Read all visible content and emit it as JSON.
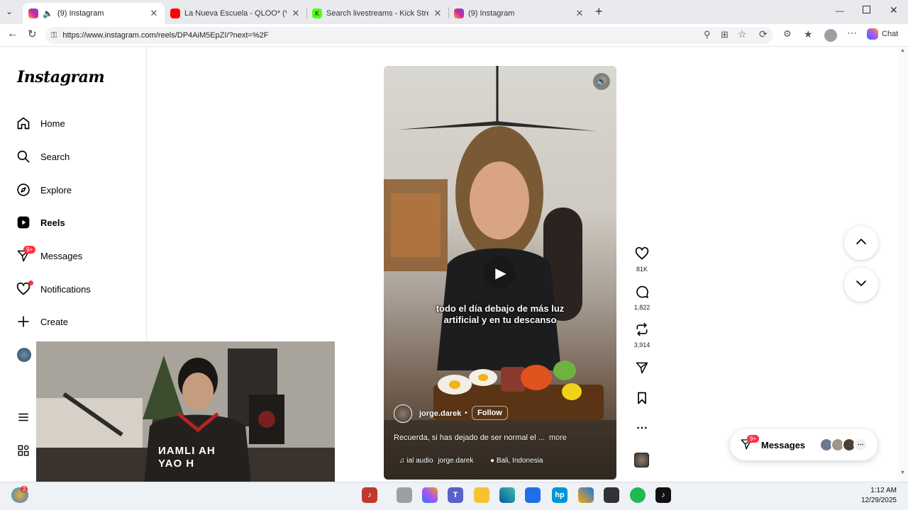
{
  "browser": {
    "tabs": [
      {
        "label": "(9) Instagram",
        "active": true,
        "icon": "instagram-icon",
        "color": "#d6249f"
      },
      {
        "label": "La Nueva Escuela - QLOO* (Video",
        "active": false,
        "icon": "youtube-icon",
        "color": "#ff0000"
      },
      {
        "label": "Search livestreams - Kick Streamin",
        "active": false,
        "icon": "kick-icon",
        "color": "#53fc18"
      },
      {
        "label": "(9) Instagram",
        "active": false,
        "icon": "instagram-icon",
        "color": "#d6249f"
      }
    ],
    "url": "https://www.instagram.com/reels/DP4AiM5EpZI/?next=%2F",
    "chat_label": "Chat"
  },
  "instagram": {
    "logo": "Instagram",
    "nav": [
      {
        "label": "Home",
        "icon": "home-icon"
      },
      {
        "label": "Search",
        "icon": "search-icon"
      },
      {
        "label": "Explore",
        "icon": "compass-icon"
      },
      {
        "label": "Reels",
        "icon": "reels-icon",
        "active": true
      },
      {
        "label": "Messages",
        "icon": "messenger-icon",
        "badge": "9+"
      },
      {
        "label": "Notifications",
        "icon": "heart-icon"
      },
      {
        "label": "Create",
        "icon": "plus-icon"
      }
    ],
    "reel": {
      "caption_line1": "todo el día debajo de más luz",
      "caption_line2": "artificial y en tu descanso",
      "username": "jorge.darek",
      "follow": "Follow",
      "description": "Recuerda, si has dejado de ser normal el ...",
      "more": "more",
      "audio": "ial audio",
      "audio_user": "jorge.darek",
      "location": "Bali, Indonesia"
    },
    "actions": {
      "likes": "81K",
      "comments": "1,822",
      "reposts": "3,914"
    },
    "messages_pill": {
      "label": "Messages",
      "badge": "9+"
    }
  },
  "webcam": {
    "shirt_text_1": "ИAMLI  AH",
    "shirt_text_2": "YAO   H"
  },
  "taskbar": {
    "weather_badge": "2",
    "time": "1:12 AM",
    "date": "12/29/2025"
  },
  "colors": {
    "accent_red": "#ff3040",
    "instagram_blue": "#0095f6"
  }
}
